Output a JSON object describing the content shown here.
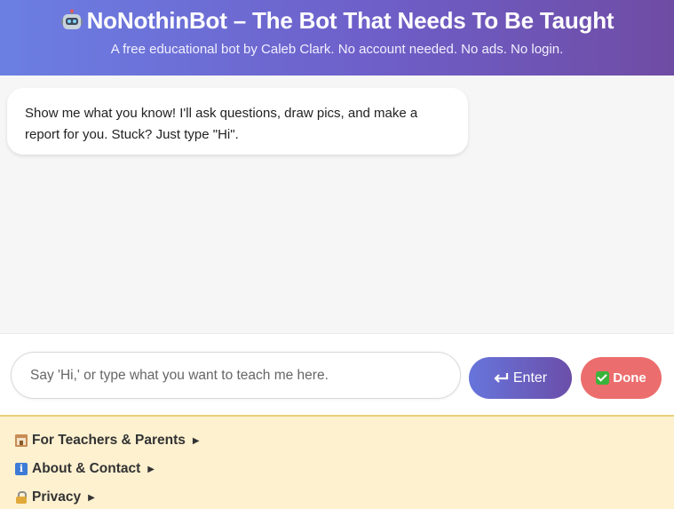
{
  "header": {
    "title": "NoNothinBot – The Bot That Needs To Be Taught",
    "subtitle": "A free educational bot by Caleb Clark. No account needed. No ads. No login.",
    "icon": "robot-icon"
  },
  "chat": {
    "messages": [
      {
        "sender": "bot",
        "text": "Show me what you know! I'll ask questions, draw pics, and make a report for you. Stuck? Just type \"Hi\"."
      }
    ]
  },
  "input": {
    "placeholder": "Say 'Hi,' or type what you want to teach me here.",
    "value": ""
  },
  "buttons": {
    "enter_label": "Enter",
    "enter_icon": "return-arrow-icon",
    "done_label": "Done",
    "done_icon": "check-mark-icon"
  },
  "footer": {
    "links": [
      {
        "label": "For Teachers & Parents",
        "icon": "school-icon"
      },
      {
        "label": "About & Contact",
        "icon": "info-icon"
      },
      {
        "label": "Privacy",
        "icon": "lock-icon"
      }
    ]
  },
  "colors": {
    "header_gradient_start": "#6b7fe3",
    "header_gradient_end": "#6f4ca4",
    "done_button": "#ec6d6d",
    "footer_background": "#fdf1d0"
  }
}
